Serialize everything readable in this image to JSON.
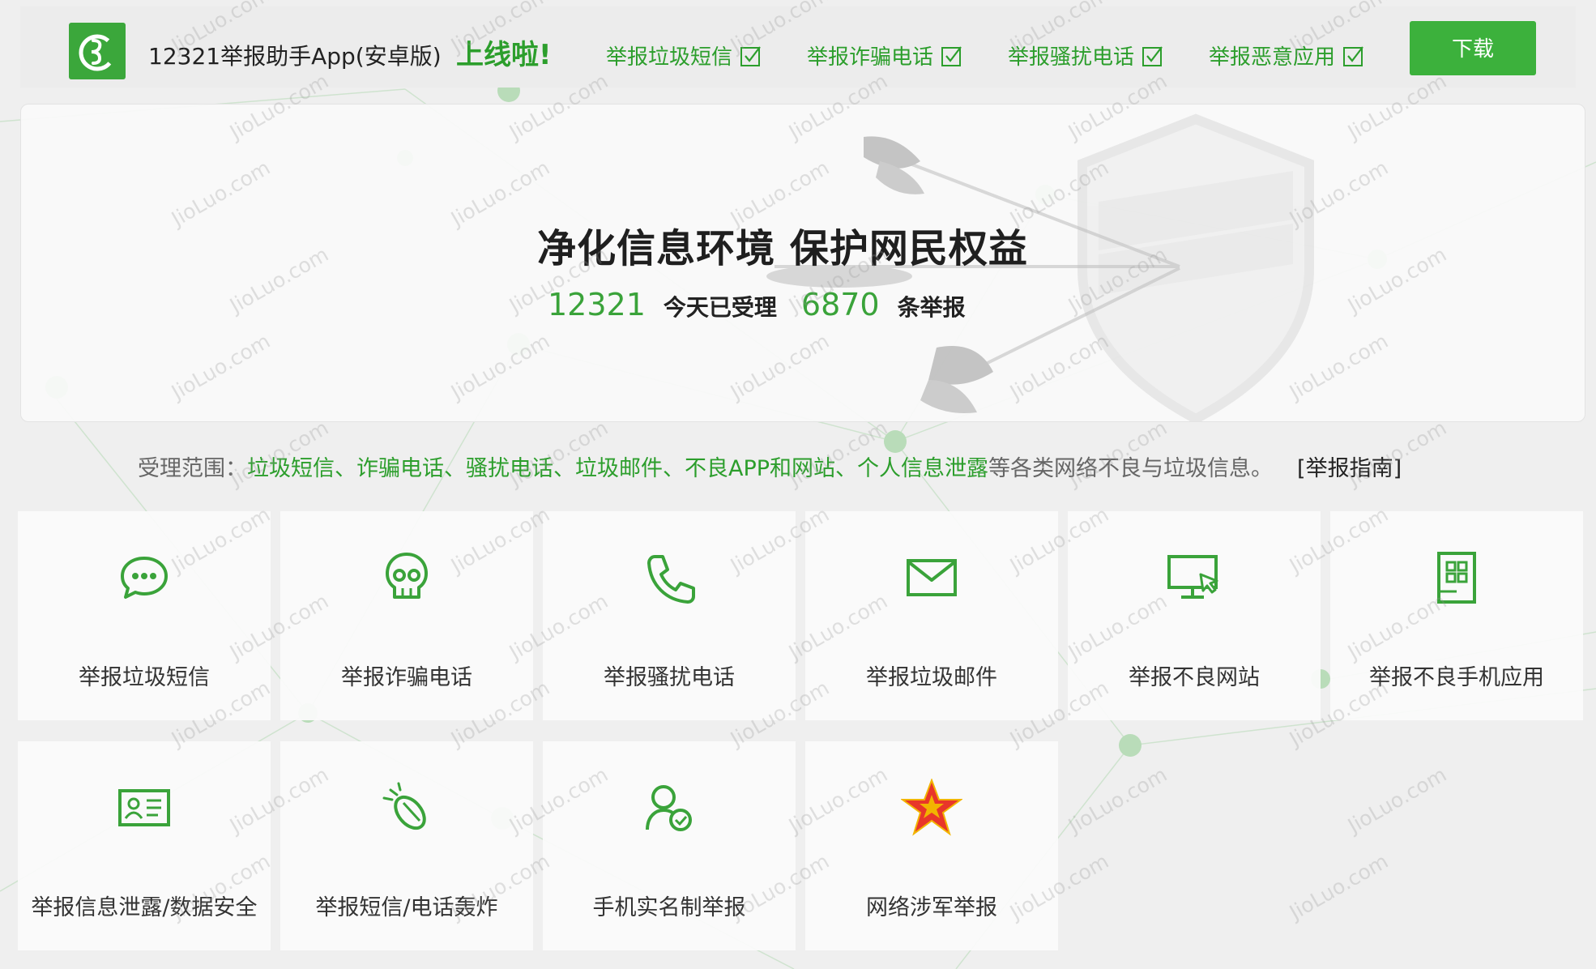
{
  "top_banner": {
    "app_text": "12321举报助手App(安卓版)",
    "launch_text": "上线啦!",
    "features": [
      "举报垃圾短信",
      "举报诈骗电话",
      "举报骚扰电话",
      "举报恶意应用"
    ],
    "download_label": "下载"
  },
  "hero": {
    "title": "净化信息环境  保护网民权益",
    "stats": {
      "hotline": "12321",
      "today_label": "今天已受理",
      "count": "6870",
      "unit_label": "条举报"
    }
  },
  "scope": {
    "prefix": "受理范围：",
    "items": "垃圾短信、诈骗电话、骚扰电话、垃圾邮件、不良APP和网站、个人信息泄露",
    "suffix": "等各类网络不良与垃圾信息。",
    "guide_link": "[举报指南]"
  },
  "tiles": [
    {
      "label": "举报垃圾短信",
      "icon": "sms-bubble-icon"
    },
    {
      "label": "举报诈骗电话",
      "icon": "skull-icon"
    },
    {
      "label": "举报骚扰电话",
      "icon": "phone-icon"
    },
    {
      "label": "举报垃圾邮件",
      "icon": "mail-icon"
    },
    {
      "label": "举报不良网站",
      "icon": "monitor-cursor-icon"
    },
    {
      "label": "举报不良手机应用",
      "icon": "mobile-app-icon"
    },
    {
      "label": "举报信息泄露/数据安全",
      "icon": "id-card-icon"
    },
    {
      "label": "举报短信/电话轰炸",
      "icon": "bomb-icon"
    },
    {
      "label": "手机实名制举报",
      "icon": "user-check-icon"
    },
    {
      "label": "网络涉军举报",
      "icon": "red-star-icon"
    }
  ],
  "watermark": "JioLuo.com",
  "colors": {
    "brand_green": "#3aa33a",
    "link_green": "#2c9e2c",
    "background": "#efefef",
    "star_red": "#e8362a"
  }
}
